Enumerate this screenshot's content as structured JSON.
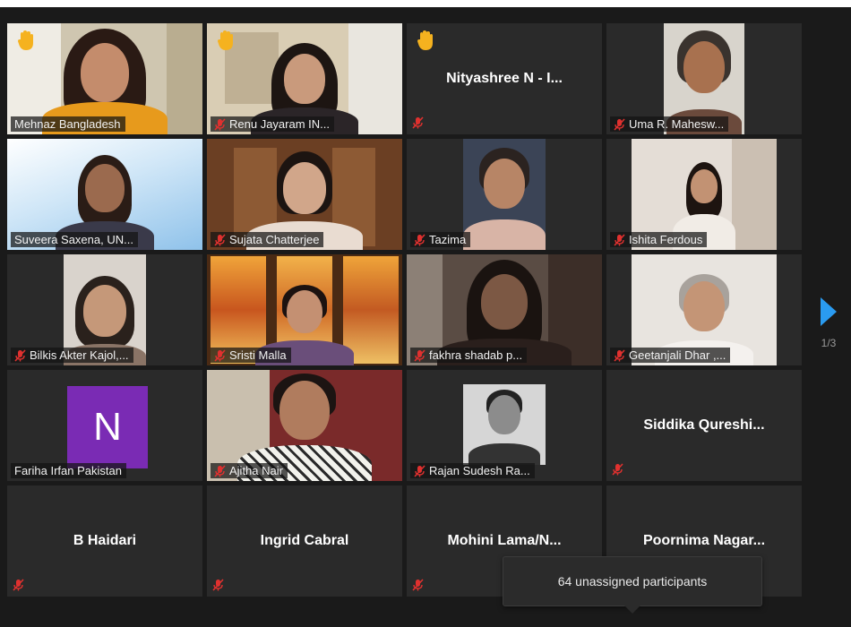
{
  "participants": [
    {
      "name": "Mehnaz Bangladesh",
      "muted": false,
      "hand": true,
      "active": true,
      "video": true
    },
    {
      "name": "Renu Jayaram IN...",
      "muted": true,
      "hand": true,
      "video": true
    },
    {
      "name": "Nityashree N - I...",
      "muted": true,
      "hand": true,
      "video": false
    },
    {
      "name": "Uma R. Mahesw...",
      "muted": true,
      "video": true
    },
    {
      "name": "Suveera Saxena, UN...",
      "muted": false,
      "video": true
    },
    {
      "name": "Sujata  Chatterjee",
      "muted": true,
      "video": true
    },
    {
      "name": "Tazima",
      "muted": true,
      "video": true
    },
    {
      "name": "Ishita Ferdous",
      "muted": true,
      "video": true
    },
    {
      "name": "Bilkis Akter Kajol,...",
      "muted": true,
      "video": true
    },
    {
      "name": "Sristi Malla",
      "muted": true,
      "video": true
    },
    {
      "name": "fakhra shadab p...",
      "muted": true,
      "video": true
    },
    {
      "name": "Geetanjali Dhar ,...",
      "muted": true,
      "video": true
    },
    {
      "name": "Fariha Irfan Pakistan",
      "muted": false,
      "video": false,
      "avatar_letter": "N"
    },
    {
      "name": "Ajitha Nair",
      "muted": true,
      "video": true
    },
    {
      "name": "Rajan Sudesh Ra...",
      "muted": true,
      "video": true
    },
    {
      "name": "Siddika  Qureshi...",
      "muted": true,
      "video": false
    },
    {
      "name": "B Haidari",
      "muted": true,
      "video": false
    },
    {
      "name": "Ingrid Cabral",
      "muted": true,
      "video": false
    },
    {
      "name": "Mohini  Lama/N...",
      "muted": true,
      "video": false
    },
    {
      "name": "Poornima  Nagar...",
      "muted": true,
      "video": false
    }
  ],
  "pagination": {
    "label": "1/3"
  },
  "popup": {
    "text": "64 unassigned participants"
  },
  "colors": {
    "active_border": "#c7e37a",
    "muted_icon": "#e0312f",
    "hand": "#f5b21f",
    "avatar": "#7a2bb4",
    "arrow": "#2a9bf0"
  }
}
